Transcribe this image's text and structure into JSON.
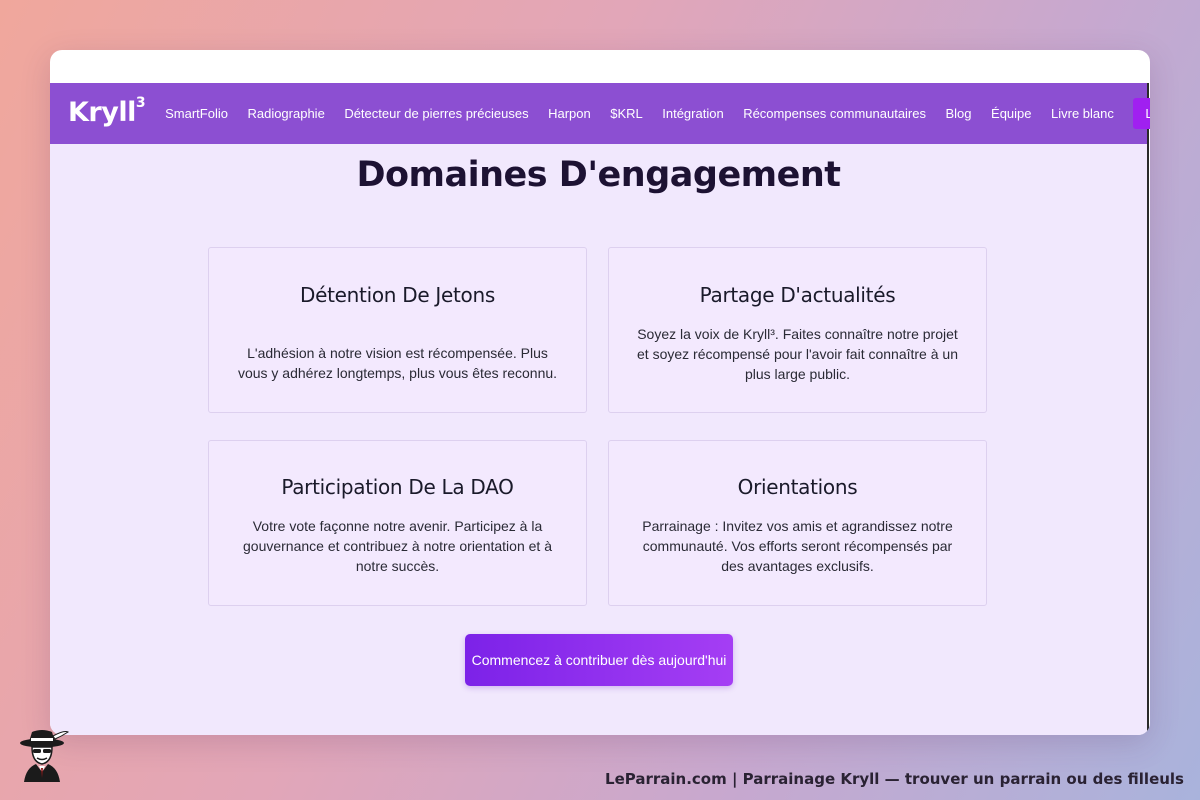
{
  "nav": {
    "logo_text": "Kryll",
    "logo_sup": "3",
    "items": [
      "SmartFolio",
      "Radiographie",
      "Détecteur de pierres précieuses",
      "Harpon",
      "$KRL",
      "Intégration",
      "Récompenses communautaires",
      "Blog",
      "Équipe",
      "Livre blanc"
    ],
    "cta_label": "Lancer l'application"
  },
  "page": {
    "title": "Domaines D'engagement",
    "cards": [
      {
        "title": "Détention De Jetons",
        "text": "L'adhésion à notre vision est récompensée. Plus vous y adhérez longtemps, plus vous êtes reconnu."
      },
      {
        "title": "Partage D'actualités",
        "text": "Soyez la voix de Kryll³. Faites connaître notre projet et soyez récompensé pour l'avoir fait connaître à un plus large public."
      },
      {
        "title": "Participation De La DAO",
        "text": "Votre vote façonne notre avenir. Participez à la gouvernance et contribuez à notre orientation et à notre succès."
      },
      {
        "title": "Orientations",
        "text": "Parrainage : Invitez vos amis et agrandissez notre communauté. Vos efforts seront récompensés par des avantages exclusifs."
      }
    ],
    "cta_label": "Commencez à contribuer dès aujourd'hui"
  },
  "footer": {
    "caption": "LeParrain.com | Parrainage Kryll — trouver un parrain ou des filleuls"
  },
  "colors": {
    "nav_bg": "#8c4fd2",
    "page_bg": "#f1e8fd",
    "accent": "#a020f0"
  }
}
